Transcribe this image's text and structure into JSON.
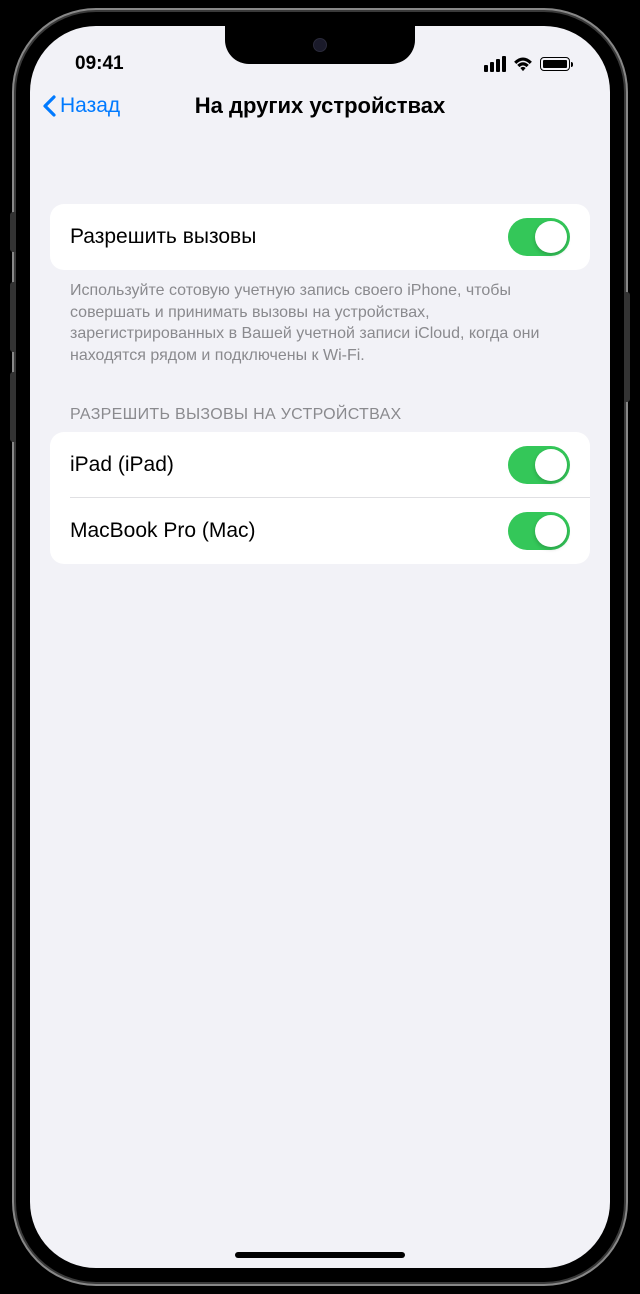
{
  "status_bar": {
    "time": "09:41"
  },
  "nav": {
    "back_label": "Назад",
    "title": "На других устройствах"
  },
  "allow_calls": {
    "label": "Разрешить вызовы",
    "enabled": true,
    "footer": "Используйте сотовую учетную запись своего iPhone, чтобы совершать и принимать вызовы на устройствах, зарегистрированных в Вашей учетной записи iCloud, когда они находятся рядом и подключены к Wi-Fi."
  },
  "devices_section": {
    "header": "РАЗРЕШИТЬ ВЫЗОВЫ НА УСТРОЙСТВАХ",
    "items": [
      {
        "label": "iPad (iPad)",
        "enabled": true
      },
      {
        "label": "MacBook Pro (Mac)",
        "enabled": true
      }
    ]
  },
  "colors": {
    "accent": "#007aff",
    "toggle_on": "#34c759",
    "background": "#f2f2f7"
  }
}
